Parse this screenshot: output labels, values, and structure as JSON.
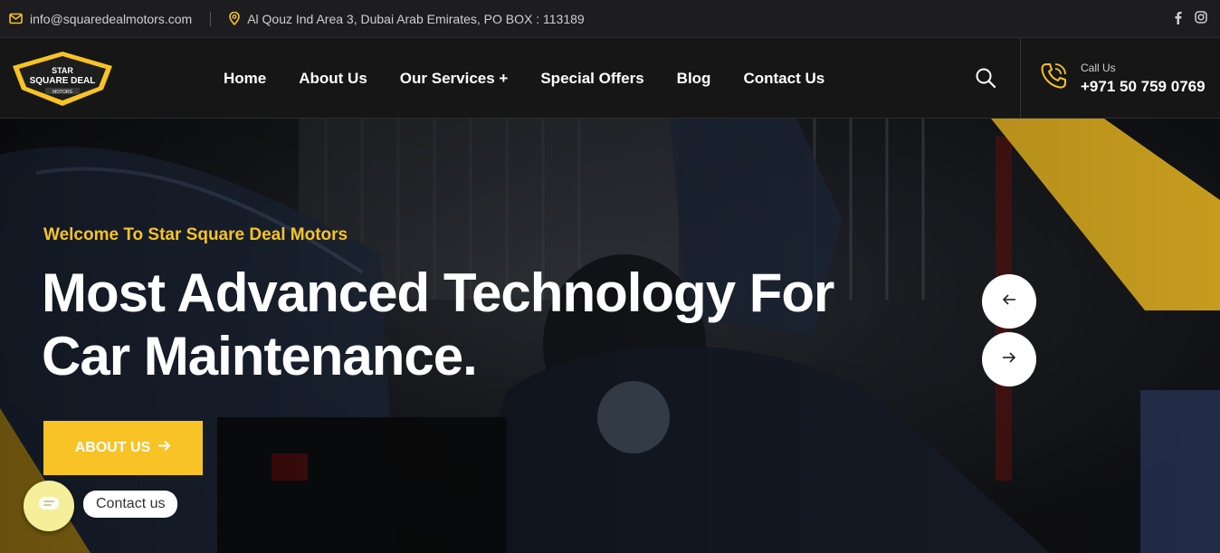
{
  "topbar": {
    "email": "info@squaredealmotors.com",
    "address": "Al Qouz Ind Area 3, Dubai Arab Emirates, PO BOX : 113189",
    "social": [
      "facebook-icon",
      "instagram-icon"
    ]
  },
  "logo": {
    "line1": "STAR",
    "line2": "SQUARE DEAL",
    "line3": "MOTORS"
  },
  "nav": {
    "items": [
      "Home",
      "About Us",
      "Our Services +",
      "Special Offers",
      "Blog",
      "Contact Us"
    ]
  },
  "call": {
    "label": "Call Us",
    "number": "+971 50 759 0769"
  },
  "hero": {
    "welcome": "Welcome To Star Square Deal Motors",
    "headline_line1": "Most Advanced Technology For",
    "headline_line2": "Car Maintenance.",
    "cta_label": "ABOUT US"
  },
  "contact_widget": {
    "label": "Contact us"
  },
  "colors": {
    "accent": "#f7c325",
    "dark": "#161616"
  }
}
